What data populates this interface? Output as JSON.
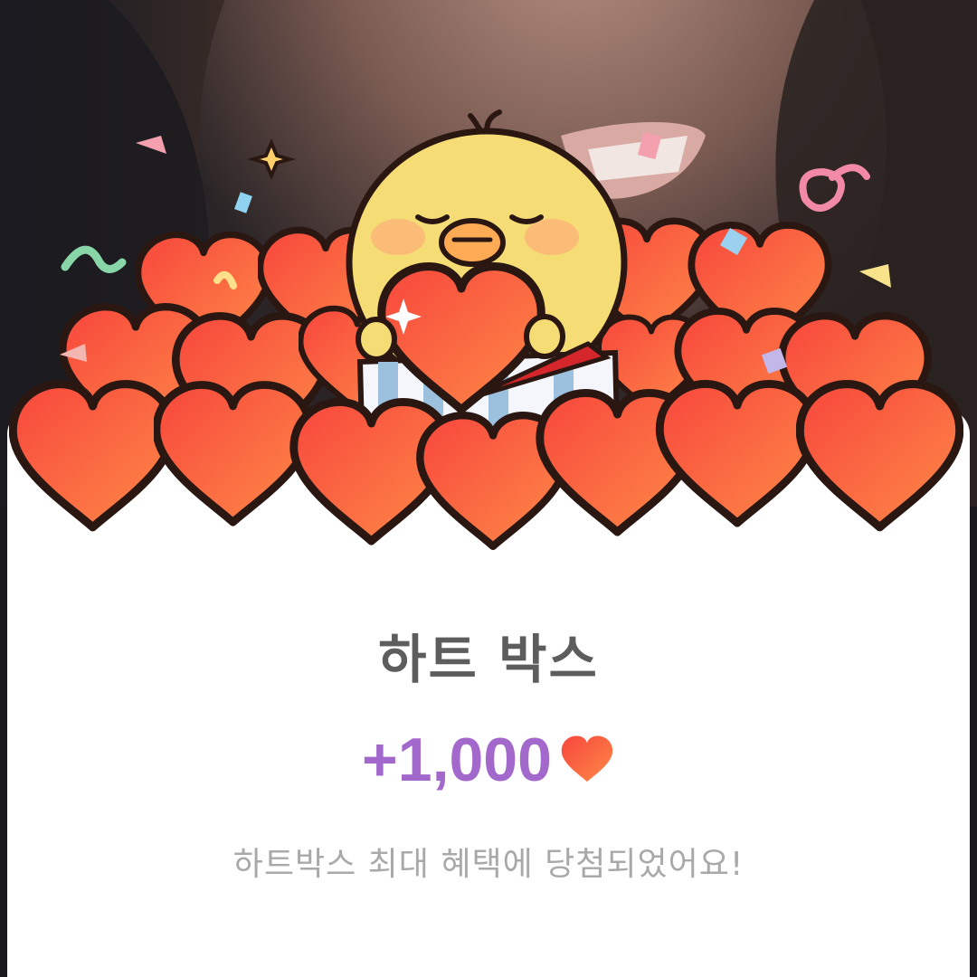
{
  "reward": {
    "title": "하트 박스",
    "amount": "+1,000",
    "currency_icon": "heart-icon",
    "message": "하트박스 최대 혜택에 당첨되었어요!"
  },
  "colors": {
    "title": "#5d5d5d",
    "amount": "#a368cc",
    "message": "#a9a9a9",
    "heart": "#f85a3e",
    "chick": "#f6dc74",
    "sheet": "#ffffff"
  }
}
